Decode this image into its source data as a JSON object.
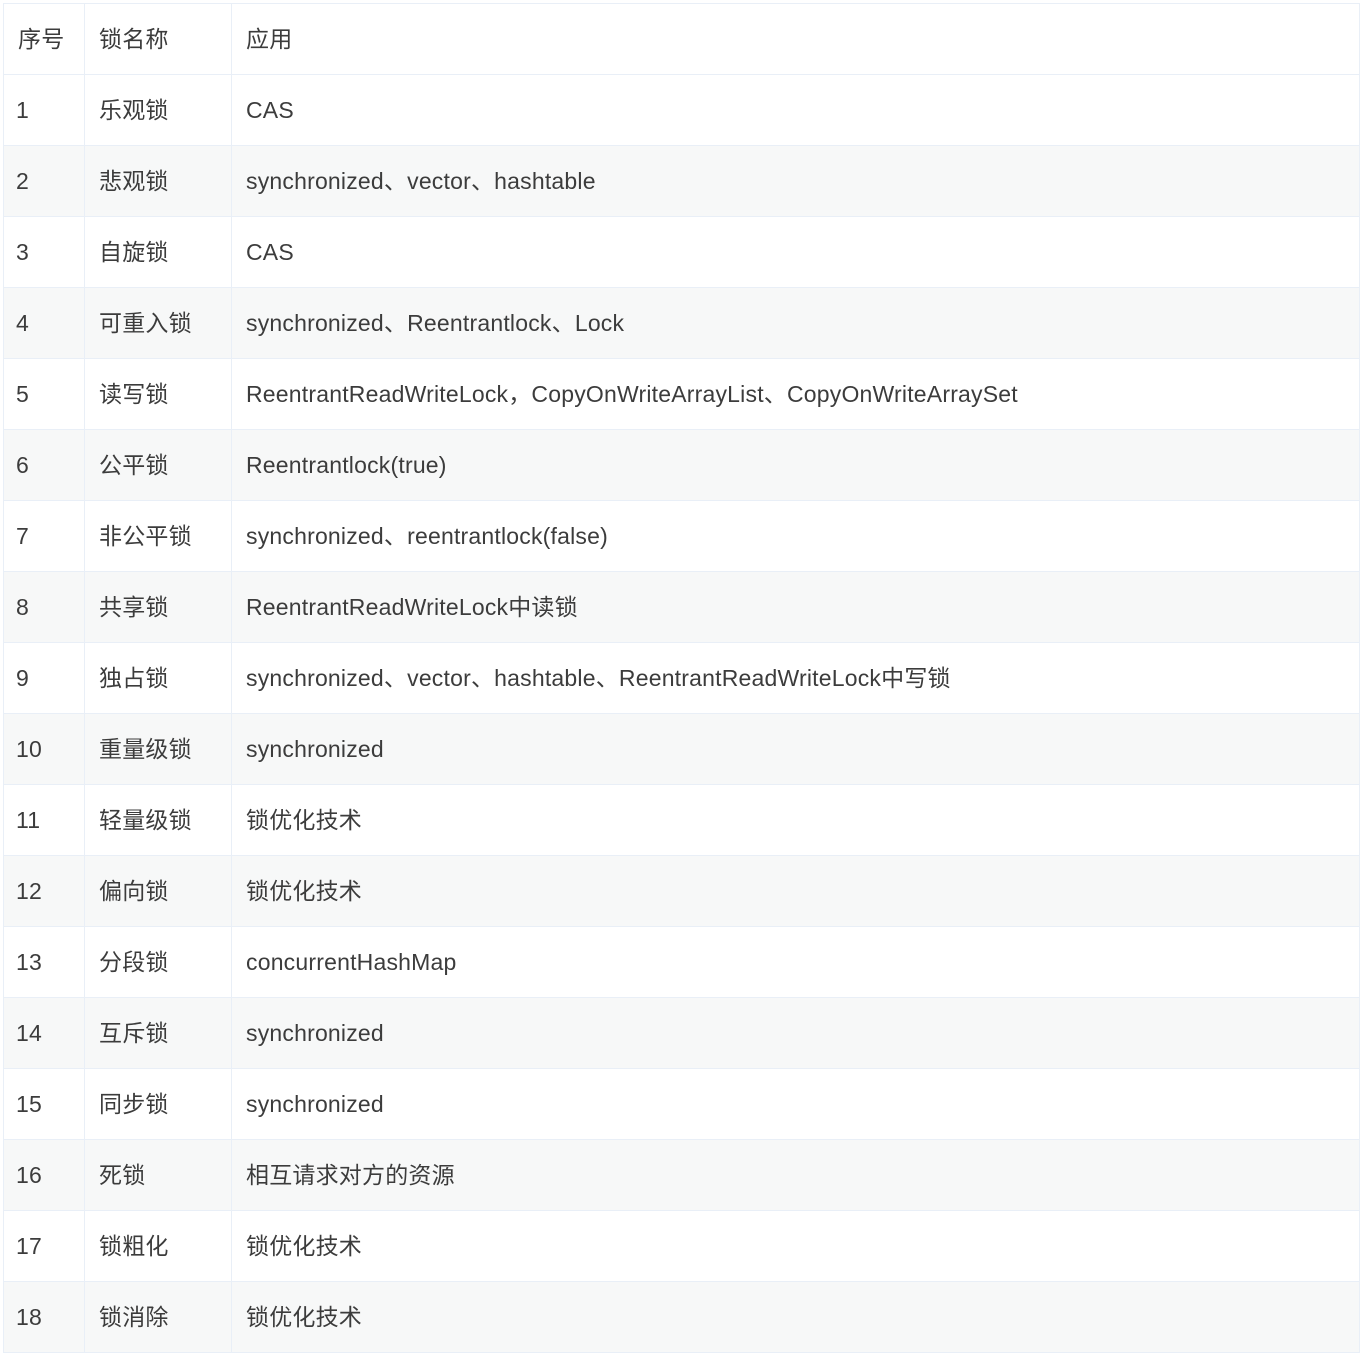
{
  "table": {
    "columns": [
      "序号",
      "锁名称",
      "应用"
    ],
    "rows": [
      {
        "index": "1",
        "name": "乐观锁",
        "application": "CAS"
      },
      {
        "index": "2",
        "name": "悲观锁",
        "application": "synchronized、vector、hashtable"
      },
      {
        "index": "3",
        "name": "自旋锁",
        "application": "CAS"
      },
      {
        "index": "4",
        "name": "可重入锁",
        "application": "synchronized、Reentrantlock、Lock"
      },
      {
        "index": "5",
        "name": "读写锁",
        "application": "ReentrantReadWriteLock，CopyOnWriteArrayList、CopyOnWriteArraySet"
      },
      {
        "index": "6",
        "name": "公平锁",
        "application": "Reentrantlock(true)"
      },
      {
        "index": "7",
        "name": "非公平锁",
        "application": "synchronized、reentrantlock(false)"
      },
      {
        "index": "8",
        "name": "共享锁",
        "application": "ReentrantReadWriteLock中读锁"
      },
      {
        "index": "9",
        "name": "独占锁",
        "application": "synchronized、vector、hashtable、ReentrantReadWriteLock中写锁"
      },
      {
        "index": "10",
        "name": "重量级锁",
        "application": "synchronized"
      },
      {
        "index": "11",
        "name": "轻量级锁",
        "application": "锁优化技术"
      },
      {
        "index": "12",
        "name": "偏向锁",
        "application": "锁优化技术"
      },
      {
        "index": "13",
        "name": "分段锁",
        "application": "concurrentHashMap"
      },
      {
        "index": "14",
        "name": "互斥锁",
        "application": "synchronized"
      },
      {
        "index": "15",
        "name": "同步锁",
        "application": "synchronized"
      },
      {
        "index": "16",
        "name": "死锁",
        "application": "相互请求对方的资源"
      },
      {
        "index": "17",
        "name": "锁粗化",
        "application": "锁优化技术"
      },
      {
        "index": "18",
        "name": "锁消除",
        "application": "锁优化技术"
      }
    ]
  },
  "colors": {
    "border": "#e9eff7",
    "stripe": "#f7f8f8",
    "text": "#3c3c3c",
    "background": "#ffffff"
  }
}
